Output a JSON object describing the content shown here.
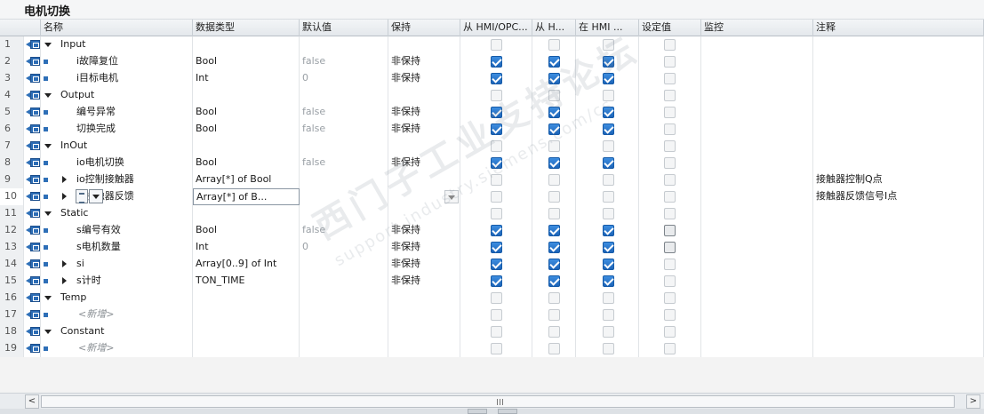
{
  "block_title": "电机切换",
  "columns": [
    "名称",
    "数据类型",
    "默认值",
    "保持",
    "从 HMI/OPC...",
    "从 H...",
    "在 HMI ...",
    "设定值",
    "监控",
    "注释"
  ],
  "rows": [
    {
      "n": "1",
      "kind": "section",
      "name": "Input",
      "type": "",
      "def": "",
      "retain": "",
      "c1": "off",
      "c2": "off",
      "c3": "off",
      "c4": "off",
      "comment": ""
    },
    {
      "n": "2",
      "kind": "item",
      "name": "i故障复位",
      "type": "Bool",
      "def": "false",
      "retain": "非保持",
      "c1": "on",
      "c2": "on",
      "c3": "on",
      "c4": "off",
      "comment": ""
    },
    {
      "n": "3",
      "kind": "item",
      "name": "i目标电机",
      "type": "Int",
      "def": "0",
      "retain": "非保持",
      "c1": "on",
      "c2": "on",
      "c3": "on",
      "c4": "off",
      "comment": ""
    },
    {
      "n": "4",
      "kind": "section",
      "name": "Output",
      "type": "",
      "def": "",
      "retain": "",
      "c1": "off",
      "c2": "off",
      "c3": "off",
      "c4": "off",
      "comment": ""
    },
    {
      "n": "5",
      "kind": "item",
      "name": "编号异常",
      "type": "Bool",
      "def": "false",
      "retain": "非保持",
      "c1": "on",
      "c2": "on",
      "c3": "on",
      "c4": "off",
      "comment": ""
    },
    {
      "n": "6",
      "kind": "item",
      "name": "切换完成",
      "type": "Bool",
      "def": "false",
      "retain": "非保持",
      "c1": "on",
      "c2": "on",
      "c3": "on",
      "c4": "off",
      "comment": ""
    },
    {
      "n": "7",
      "kind": "section",
      "name": "InOut",
      "type": "",
      "def": "",
      "retain": "",
      "c1": "off",
      "c2": "off",
      "c3": "off",
      "c4": "off",
      "comment": ""
    },
    {
      "n": "8",
      "kind": "item",
      "name": "io电机切换",
      "type": "Bool",
      "def": "false",
      "retain": "非保持",
      "c1": "on",
      "c2": "on",
      "c3": "on",
      "c4": "off",
      "comment": ""
    },
    {
      "n": "9",
      "kind": "array",
      "name": "io控制接触器",
      "type": "Array[*] of Bool",
      "def": "",
      "retain": "",
      "c1": "off",
      "c2": "off",
      "c3": "off",
      "c4": "off",
      "comment": "接触器控制Q点"
    },
    {
      "n": "10",
      "kind": "editing",
      "name": "io接触器反馈",
      "type": "Array[*] of B...",
      "def": "",
      "retain": "",
      "c1": "off",
      "c2": "off",
      "c3": "off",
      "c4": "off",
      "comment": "接触器反馈信号I点"
    },
    {
      "n": "11",
      "kind": "section",
      "name": "Static",
      "type": "",
      "def": "",
      "retain": "",
      "c1": "off",
      "c2": "off",
      "c3": "off",
      "c4": "off",
      "comment": ""
    },
    {
      "n": "12",
      "kind": "item",
      "name": "s编号有效",
      "type": "Bool",
      "def": "false",
      "retain": "非保持",
      "c1": "on",
      "c2": "on",
      "c3": "on",
      "c4": "act",
      "comment": ""
    },
    {
      "n": "13",
      "kind": "item",
      "name": "s电机数量",
      "type": "Int",
      "def": "0",
      "retain": "非保持",
      "c1": "on",
      "c2": "on",
      "c3": "on",
      "c4": "act",
      "comment": ""
    },
    {
      "n": "14",
      "kind": "array",
      "name": "si",
      "type": "Array[0..9] of Int",
      "def": "",
      "retain": "非保持",
      "c1": "on",
      "c2": "on",
      "c3": "on",
      "c4": "off",
      "comment": ""
    },
    {
      "n": "15",
      "kind": "array",
      "name": "s计时",
      "type": "TON_TIME",
      "def": "",
      "retain": "非保持",
      "c1": "on",
      "c2": "on",
      "c3": "on",
      "c4": "off",
      "comment": ""
    },
    {
      "n": "16",
      "kind": "section",
      "name": "Temp",
      "type": "",
      "def": "",
      "retain": "",
      "c1": "off",
      "c2": "off",
      "c3": "off",
      "c4": "off",
      "comment": ""
    },
    {
      "n": "17",
      "kind": "add",
      "name": "<新增>",
      "type": "",
      "def": "",
      "retain": "",
      "c1": "off",
      "c2": "off",
      "c3": "off",
      "c4": "off",
      "comment": ""
    },
    {
      "n": "18",
      "kind": "section",
      "name": "Constant",
      "type": "",
      "def": "",
      "retain": "",
      "c1": "off",
      "c2": "off",
      "c3": "off",
      "c4": "off",
      "comment": ""
    },
    {
      "n": "19",
      "kind": "add",
      "name": "<新增>",
      "type": "",
      "def": "",
      "retain": "",
      "c1": "off",
      "c2": "off",
      "c3": "off",
      "c4": "off",
      "comment": ""
    }
  ],
  "scrollbar": {
    "left_arrow": "<",
    "right_arrow": ">"
  },
  "watermark": {
    "line1": "西门子工业支持论坛",
    "line2": "support.industry.siemens.com/cs"
  }
}
